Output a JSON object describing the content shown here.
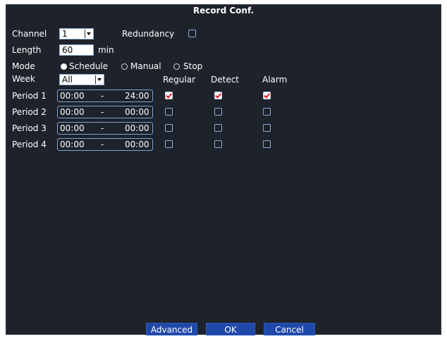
{
  "title": "Record Conf.",
  "channel": {
    "label": "Channel",
    "value": "1"
  },
  "redundancy": {
    "label": "Redundancy",
    "checked": false
  },
  "length": {
    "label": "Length",
    "value": "60",
    "unit": "min"
  },
  "mode": {
    "label": "Mode",
    "options": [
      "Schedule",
      "Manual",
      "Stop"
    ],
    "selected": "Schedule"
  },
  "week": {
    "label": "Week",
    "value": "All"
  },
  "columns": [
    "Regular",
    "Detect",
    "Alarm"
  ],
  "periods": [
    {
      "label": "Period 1",
      "start": "00:00",
      "sep": "-",
      "end": "24:00",
      "regular": true,
      "detect": true,
      "alarm": true
    },
    {
      "label": "Period 2",
      "start": "00:00",
      "sep": "-",
      "end": "00:00",
      "regular": false,
      "detect": false,
      "alarm": false
    },
    {
      "label": "Period 3",
      "start": "00:00",
      "sep": "-",
      "end": "00:00",
      "regular": false,
      "detect": false,
      "alarm": false
    },
    {
      "label": "Period 4",
      "start": "00:00",
      "sep": "-",
      "end": "00:00",
      "regular": false,
      "detect": false,
      "alarm": false
    }
  ],
  "buttons": {
    "advanced": "Advanced",
    "ok": "OK",
    "cancel": "Cancel"
  }
}
